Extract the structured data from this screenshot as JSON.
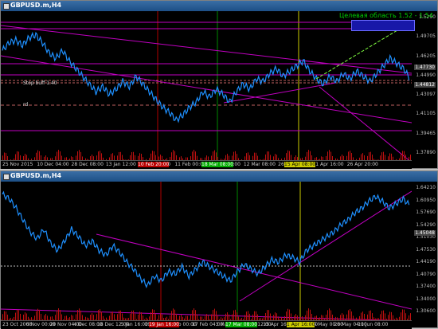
{
  "colors": {
    "background": "#000000",
    "price": "#1e90ff",
    "trend": "#c000c0",
    "red_line": "#b00000",
    "green_line": "#008800",
    "yellow_line": "#cccc00",
    "volume": "#c01010",
    "target_box": "#1818a8",
    "annotation": "#00d000"
  },
  "top_chart": {
    "title": "GBPUSD.m,H4",
    "annotation": "Целевая область 1.52 - 1.54",
    "stop_label": "Stop buff 1.40",
    "level_label": "rd",
    "y_ticks": [
      "1.5290",
      "1.49705",
      "1.46205",
      "1.44990",
      "1.43097",
      "1.41105",
      "1.39465",
      "1.37890"
    ],
    "y_boxed": [
      "1.47730",
      "1.44812"
    ],
    "x_ticks": [
      "25 Nov 2015",
      "10 Dec 04:00",
      "28 Dec 08:00",
      "13 Jan 12:00",
      "27 Jan 16:00",
      "11 Feb 00:00",
      "26 Feb 04:00",
      "12 Mar 08:00",
      "26 Mar 12:00",
      "11 Apr 16:00",
      "26 Apr 20:00"
    ],
    "x_highlight": [
      {
        "label": "10 Feb 20:00",
        "style": "hl-red"
      },
      {
        "label": "18 Mar 08:00",
        "style": "hl-green"
      },
      {
        "label": "15 Apr 08:00",
        "style": "hl-yellow"
      }
    ],
    "series_points": [
      0.72,
      0.78,
      0.8,
      0.76,
      0.82,
      0.84,
      0.78,
      0.7,
      0.66,
      0.72,
      0.64,
      0.58,
      0.52,
      0.46,
      0.4,
      0.44,
      0.38,
      0.42,
      0.48,
      0.44,
      0.52,
      0.46,
      0.4,
      0.34,
      0.28,
      0.24,
      0.18,
      0.22,
      0.28,
      0.32,
      0.4,
      0.36,
      0.42,
      0.38,
      0.32,
      0.4,
      0.46,
      0.42,
      0.5,
      0.48,
      0.54,
      0.58,
      0.52,
      0.56,
      0.6,
      0.64,
      0.56,
      0.5,
      0.46,
      0.52,
      0.48,
      0.54,
      0.5,
      0.56,
      0.52,
      0.48,
      0.54,
      0.6,
      0.66,
      0.62,
      0.58,
      0.5
    ]
  },
  "bottom_chart": {
    "title": "GBPUSD.m,H4",
    "y_ticks": [
      "1.64210",
      "1.60950",
      "1.57690",
      "1.54290",
      "1.51030",
      "1.47530",
      "1.44190",
      "1.40790",
      "1.37400",
      "1.34000",
      "1.30600"
    ],
    "y_boxed": [
      "1.45048"
    ],
    "x_ticks": [
      "23 Oct 2008",
      "6 Nov 00:00",
      "20 Nov 04:00",
      "4 Dec 08:00",
      "18 Dec 12:00",
      "5 Jan 16:00",
      "19 Jan 20:00",
      "2 Feb 00:00",
      "17 Feb 04:00",
      "3 Mar 08:00",
      "30 Mar 12:00",
      "15 Apr 16:00",
      "29 Apr 20:00",
      "14 May 00:00",
      "28 May 04:00",
      "11 Jun 08:00"
    ],
    "x_highlight": [
      {
        "label": "19 Jan 16:00",
        "style": "hl-red"
      },
      {
        "label": "17 Mar 08:00",
        "style": "hl-green"
      },
      {
        "label": "1 Apr 16:00",
        "style": "hl-yellow"
      }
    ],
    "series_points": [
      0.92,
      0.88,
      0.8,
      0.7,
      0.6,
      0.54,
      0.62,
      0.5,
      0.44,
      0.52,
      0.62,
      0.56,
      0.48,
      0.52,
      0.44,
      0.4,
      0.48,
      0.42,
      0.34,
      0.28,
      0.2,
      0.14,
      0.22,
      0.18,
      0.26,
      0.24,
      0.3,
      0.22,
      0.28,
      0.34,
      0.3,
      0.26,
      0.22,
      0.18,
      0.26,
      0.32,
      0.28,
      0.24,
      0.3,
      0.36,
      0.34,
      0.4,
      0.38,
      0.34,
      0.44,
      0.48,
      0.52,
      0.56,
      0.6,
      0.66,
      0.7,
      0.76,
      0.8,
      0.86,
      0.9,
      0.86,
      0.8,
      0.84,
      0.88,
      0.82
    ]
  }
}
